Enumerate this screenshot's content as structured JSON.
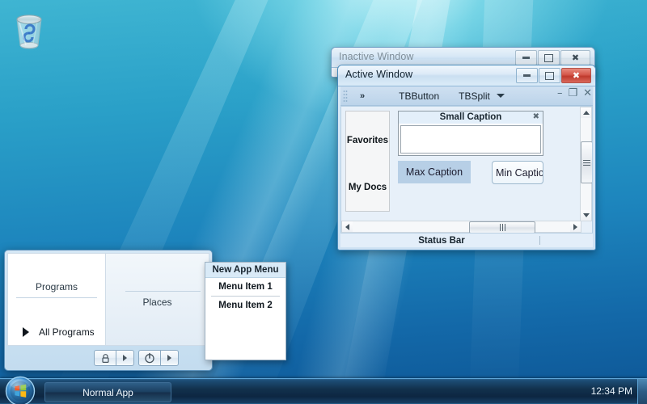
{
  "desktop": {
    "recycle_bin_label": "",
    "icon": "recycle-bin-icon"
  },
  "inactive_window": {
    "title": "Inactive Window",
    "controls": {
      "minimize": "minimize-icon",
      "maximize": "maximize-icon",
      "close": "close-icon"
    }
  },
  "active_window": {
    "title": "Active Window",
    "controls": {
      "minimize": "minimize-icon",
      "maximize": "maximize-icon",
      "close": "close-icon"
    },
    "toolbar": {
      "gripper": "gripper-handle",
      "overflow_label": "»",
      "button_label": "TBButton",
      "split_label": "TBSplit",
      "split_caret": "chevron-down-icon"
    },
    "mdi_controls": {
      "minimize": "–",
      "restore": "❐",
      "close": "✕"
    },
    "sidebar": {
      "items": [
        {
          "label": "Favorites"
        },
        {
          "label": "My Docs"
        }
      ]
    },
    "group_small": {
      "caption": "Small Caption",
      "close_icon": "close-icon",
      "body_text": ""
    },
    "buttons": {
      "max_caption": "Max Caption",
      "min_caption": "Min Caption"
    },
    "status_bar": {
      "text": "Status Bar"
    },
    "scrollbars": {
      "vertical_up": "arrow-up-icon",
      "vertical_down": "arrow-down-icon",
      "horizontal_left": "arrow-left-icon",
      "horizontal_right": "arrow-right-icon"
    }
  },
  "start_menu": {
    "left_panel": {
      "header": "Programs",
      "all_programs": "All Programs",
      "all_programs_arrow": "arrow-right-icon"
    },
    "right_panel": {
      "header": "Places"
    },
    "footer": {
      "lock_icon": "lock-icon",
      "lock_arrow": "arrow-right-icon",
      "power_icon": "power-icon",
      "power_arrow": "arrow-right-icon"
    }
  },
  "app_menu": {
    "header": "New App Menu",
    "items": [
      {
        "label": "Menu Item 1"
      },
      {
        "label": "Menu Item 2"
      }
    ]
  },
  "taskbar": {
    "start_orb": "windows-logo-icon",
    "task_button": "Normal App",
    "clock": "12:34 PM",
    "show_desktop": "show-desktop-button"
  },
  "colors": {
    "accent_blue": "#1d85bd",
    "close_red": "#bf3a2d",
    "taskbar_dark": "#12314d",
    "selection_blue": "#b7cfe6"
  }
}
